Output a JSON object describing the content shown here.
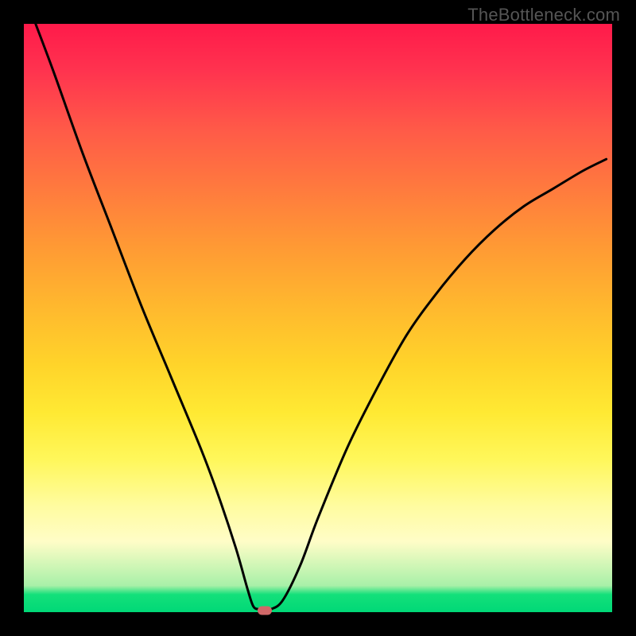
{
  "watermark": "TheBottleneck.com",
  "chart_data": {
    "type": "line",
    "title": "",
    "xlabel": "",
    "ylabel": "",
    "xlim": [
      0,
      100
    ],
    "ylim": [
      0,
      100
    ],
    "grid": false,
    "series": [
      {
        "name": "bottleneck-curve",
        "x": [
          2,
          5,
          10,
          15,
          20,
          25,
          30,
          33,
          36,
          38,
          39,
          40,
          41,
          42,
          44,
          47,
          50,
          55,
          60,
          65,
          70,
          75,
          80,
          85,
          90,
          95,
          99
        ],
        "values": [
          100,
          92,
          78,
          65,
          52,
          40,
          28,
          20,
          11,
          4,
          1,
          0.5,
          0.5,
          0.5,
          2,
          8,
          16,
          28,
          38,
          47,
          54,
          60,
          65,
          69,
          72,
          75,
          77
        ]
      }
    ],
    "marker": {
      "x": 41,
      "y": 0.3
    },
    "background_gradient": {
      "top": "#ff1a4a",
      "middle": "#ffe933",
      "bottom": "#00d877"
    }
  }
}
